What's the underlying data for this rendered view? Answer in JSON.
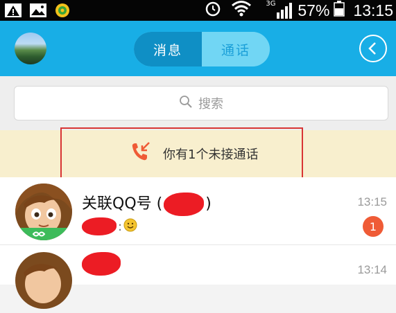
{
  "status_bar": {
    "icons": [
      "warning-icon",
      "gallery-icon",
      "app-notification-icon",
      "alarm-icon",
      "wifi-icon",
      "signal-icon",
      "battery-icon"
    ],
    "network_label": "3G",
    "battery": "57%",
    "time": "13:15"
  },
  "header": {
    "tabs": [
      {
        "label": "消息",
        "active": true
      },
      {
        "label": "通话",
        "active": false
      }
    ],
    "accent_color": "#18aee6"
  },
  "search": {
    "placeholder": "搜索"
  },
  "missed_call_banner": {
    "text": "你有1个未接通话",
    "icon": "missed-call-icon"
  },
  "conversations": [
    {
      "title_prefix": "关联QQ号 (",
      "title_suffix": ")",
      "time": "13:15",
      "unread": "1"
    },
    {
      "time": "13:14"
    }
  ]
}
